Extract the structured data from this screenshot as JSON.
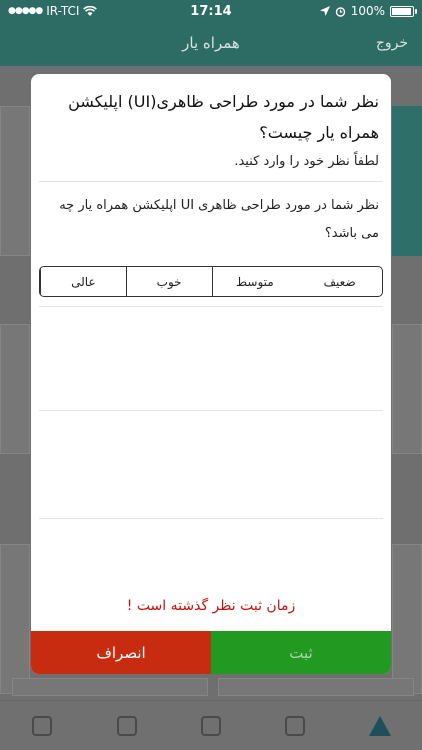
{
  "status": {
    "carrier": "IR-TCI",
    "time": "17:14",
    "battery": "100%",
    "battery_fill": 1.0
  },
  "nav": {
    "title": "همراه یار",
    "logout": "خروج"
  },
  "modal": {
    "heading": "نظر شما در مورد طراحی ظاهری(UI) اپلیکشن همراه یار چیست؟",
    "subtitle": "لطفاً نظر خود را وارد کنید.",
    "question": "نظر شما در مورد طراحی ظاهری UI اپلیکشن همراه یار چه می باشد؟",
    "options": [
      "ضعیف",
      "متوسط",
      "خوب",
      "عالی"
    ],
    "expired_message": "زمان ثبت نظر گذشته است !",
    "submit_label": "ثبت",
    "cancel_label": "انصراف"
  },
  "colors": {
    "brand": "#2d6b65",
    "submit": "#229a21",
    "cancel": "#c72b10",
    "warning_text": "#c0140c"
  },
  "icons": {
    "wifi": "wifi-icon",
    "location": "location-arrow-icon",
    "alarm": "alarm-icon",
    "battery": "battery-icon"
  }
}
